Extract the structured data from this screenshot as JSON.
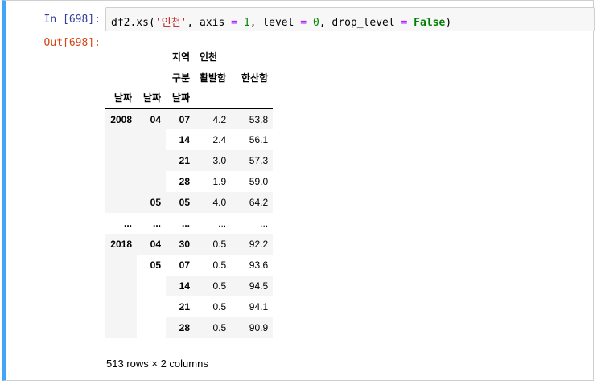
{
  "cell": {
    "in_prompt": "In [698]:",
    "out_prompt": "Out[698]:",
    "code_tokens": [
      {
        "t": "df2.xs(",
        "c": ""
      },
      {
        "t": "'인천'",
        "c": "tk-str"
      },
      {
        "t": ", axis ",
        "c": ""
      },
      {
        "t": "=",
        "c": "tk-op"
      },
      {
        "t": " ",
        "c": ""
      },
      {
        "t": "1",
        "c": "tk-num"
      },
      {
        "t": ", level ",
        "c": ""
      },
      {
        "t": "=",
        "c": "tk-op"
      },
      {
        "t": " ",
        "c": ""
      },
      {
        "t": "0",
        "c": "tk-num"
      },
      {
        "t": ", drop_level ",
        "c": ""
      },
      {
        "t": "=",
        "c": "tk-op"
      },
      {
        "t": " ",
        "c": ""
      },
      {
        "t": "False",
        "c": "tk-kw"
      },
      {
        "t": ")",
        "c": ""
      }
    ]
  },
  "table": {
    "col_level0_name": "지역",
    "col_level0_value": "인천",
    "col_level1_name": "구분",
    "columns": [
      "활발함",
      "한산함"
    ],
    "index_names": [
      "날짜",
      "날짜",
      "날짜"
    ],
    "rows": [
      {
        "i0": "2008",
        "i1": "04",
        "i2": "07",
        "v": [
          "4.2",
          "53.8"
        ]
      },
      {
        "i0": "",
        "i1": "",
        "i2": "14",
        "v": [
          "2.4",
          "56.1"
        ]
      },
      {
        "i0": "",
        "i1": "",
        "i2": "21",
        "v": [
          "3.0",
          "57.3"
        ]
      },
      {
        "i0": "",
        "i1": "",
        "i2": "28",
        "v": [
          "1.9",
          "59.0"
        ]
      },
      {
        "i0": "",
        "i1": "05",
        "i2": "05",
        "v": [
          "4.0",
          "64.2"
        ]
      },
      {
        "i0": "...",
        "i1": "...",
        "i2": "...",
        "v": [
          "...",
          "..."
        ]
      },
      {
        "i0": "2018",
        "i1": "04",
        "i2": "30",
        "v": [
          "0.5",
          "92.2"
        ]
      },
      {
        "i0": "",
        "i1": "05",
        "i2": "07",
        "v": [
          "0.5",
          "93.6"
        ]
      },
      {
        "i0": "",
        "i1": "",
        "i2": "14",
        "v": [
          "0.5",
          "94.5"
        ]
      },
      {
        "i0": "",
        "i1": "",
        "i2": "21",
        "v": [
          "0.5",
          "94.1"
        ]
      },
      {
        "i0": "",
        "i1": "",
        "i2": "28",
        "v": [
          "0.5",
          "90.9"
        ]
      }
    ]
  },
  "rows_info": "513 rows × 2 columns",
  "colors": {
    "cell_accent": "#42a5f5",
    "in_prompt": "#303f9f",
    "out_prompt": "#d84315",
    "string": "#ba2121",
    "number": "#008800",
    "operator": "#aa22ff",
    "keyword": "#008000"
  }
}
